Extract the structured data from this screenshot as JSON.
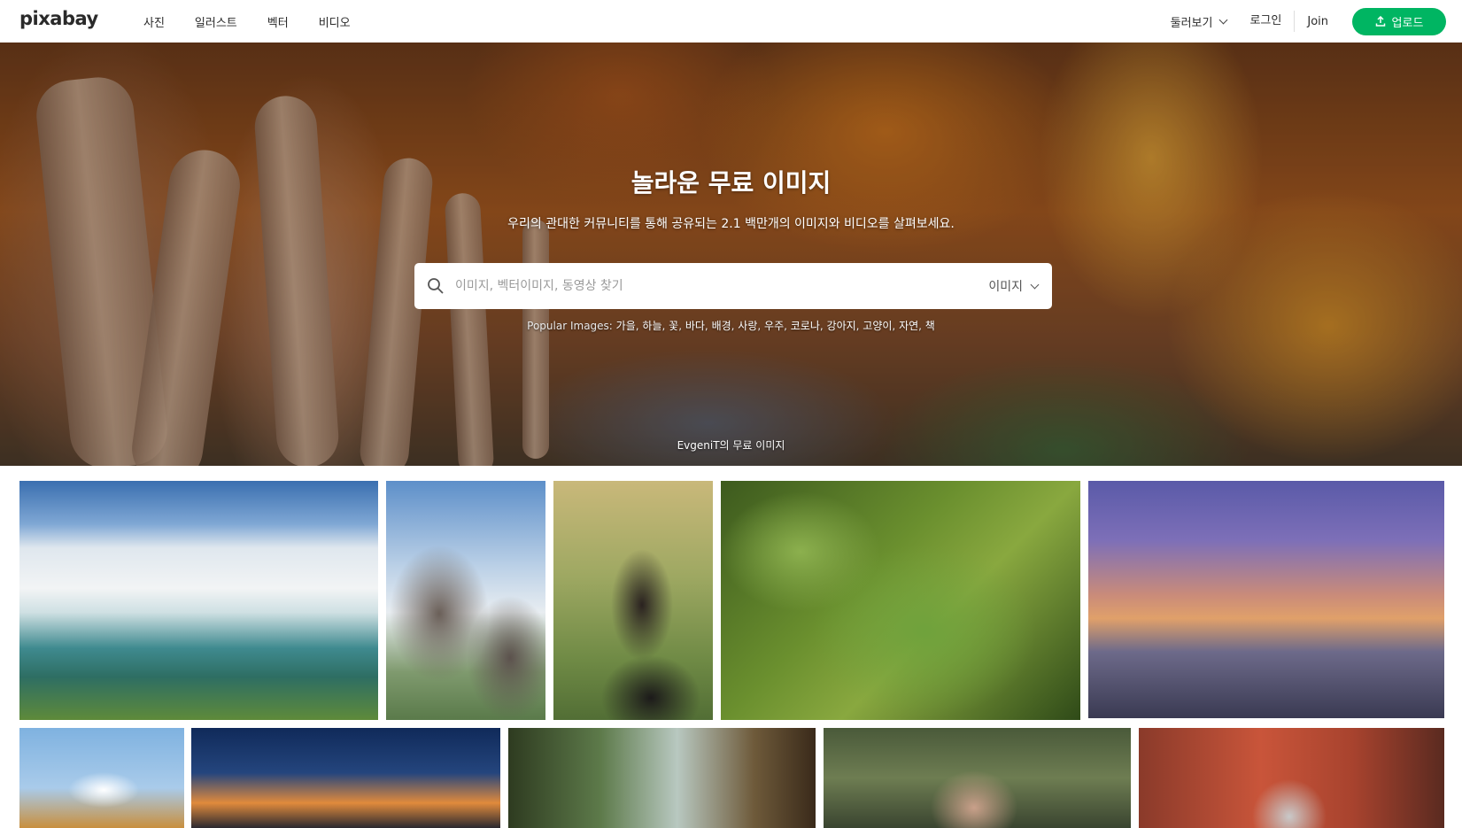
{
  "header": {
    "logo": "pixabay",
    "nav": [
      "사진",
      "일러스트",
      "벡터",
      "비디오"
    ],
    "explore": "둘러보기",
    "login": "로그인",
    "join": "Join",
    "upload": "업로드"
  },
  "hero": {
    "title": "놀라운 무료 이미지",
    "subtitle": "우리의 관대한 커뮤니티를 통해 공유되는 2.1 백만개의 이미지와 비디오를 살펴보세요.",
    "search_placeholder": "이미지, 벡터이미지, 동영상 찾기",
    "search_type": "이미지",
    "popular_label": "Popular Images:",
    "popular_tags": [
      "가을",
      "하늘",
      "꽃",
      "바다",
      "배경",
      "사랑",
      "우주",
      "코로나",
      "강아지",
      "고양이",
      "자연",
      "책"
    ],
    "credit": "EvgeniT의 무료 이미지"
  },
  "colors": {
    "accent": "#00b562",
    "text": "#191b26"
  }
}
